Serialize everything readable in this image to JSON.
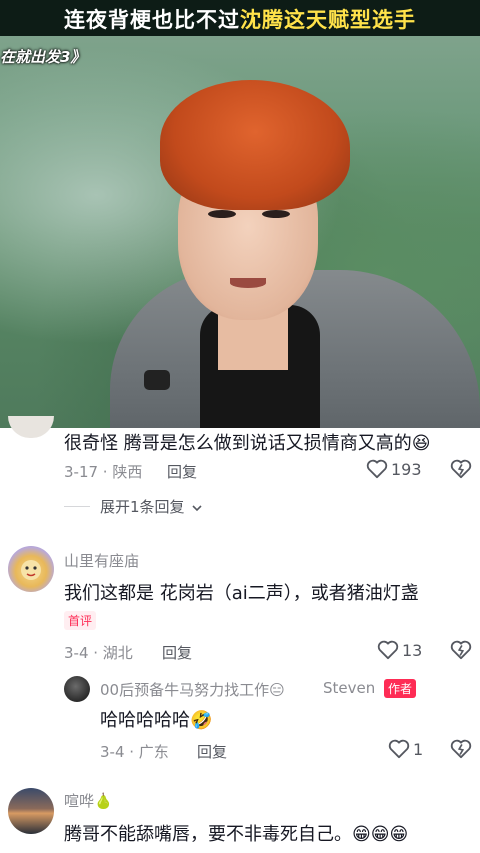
{
  "video": {
    "title_prefix": "连夜背梗也比不过",
    "title_highlight": "沈腾这天赋型选手",
    "show_tag": "在就出发3》"
  },
  "comments": [
    {
      "text": "很奇怪 腾哥是怎么做到说话又损情商又高的",
      "emoji": "😆",
      "date_location": "3-17 · 陕西",
      "reply_label": "回复",
      "like_count": "193",
      "expand_label": "展开1条回复"
    },
    {
      "username": "山里有座庙",
      "text": "我们这都是 花岗岩（ai二声），或者猪油灯盏",
      "badge": "首评",
      "date_location": "3-4 · 湖北",
      "reply_label": "回复",
      "like_count": "13",
      "reply": {
        "username": "00后预备牛马努力找工作",
        "username_emoji": "😑",
        "author_name": "Steven",
        "author_badge": "作者",
        "text": "哈哈哈哈哈",
        "text_emoji": "🤣",
        "date_location": "3-4 · 广东",
        "reply_label": "回复",
        "like_count": "1"
      }
    },
    {
      "username": "喧哗",
      "username_emoji": "🍐",
      "text": "腾哥不能舔嘴唇，要不非毒死自己。",
      "text_emoji": "😁😁😁"
    }
  ]
}
